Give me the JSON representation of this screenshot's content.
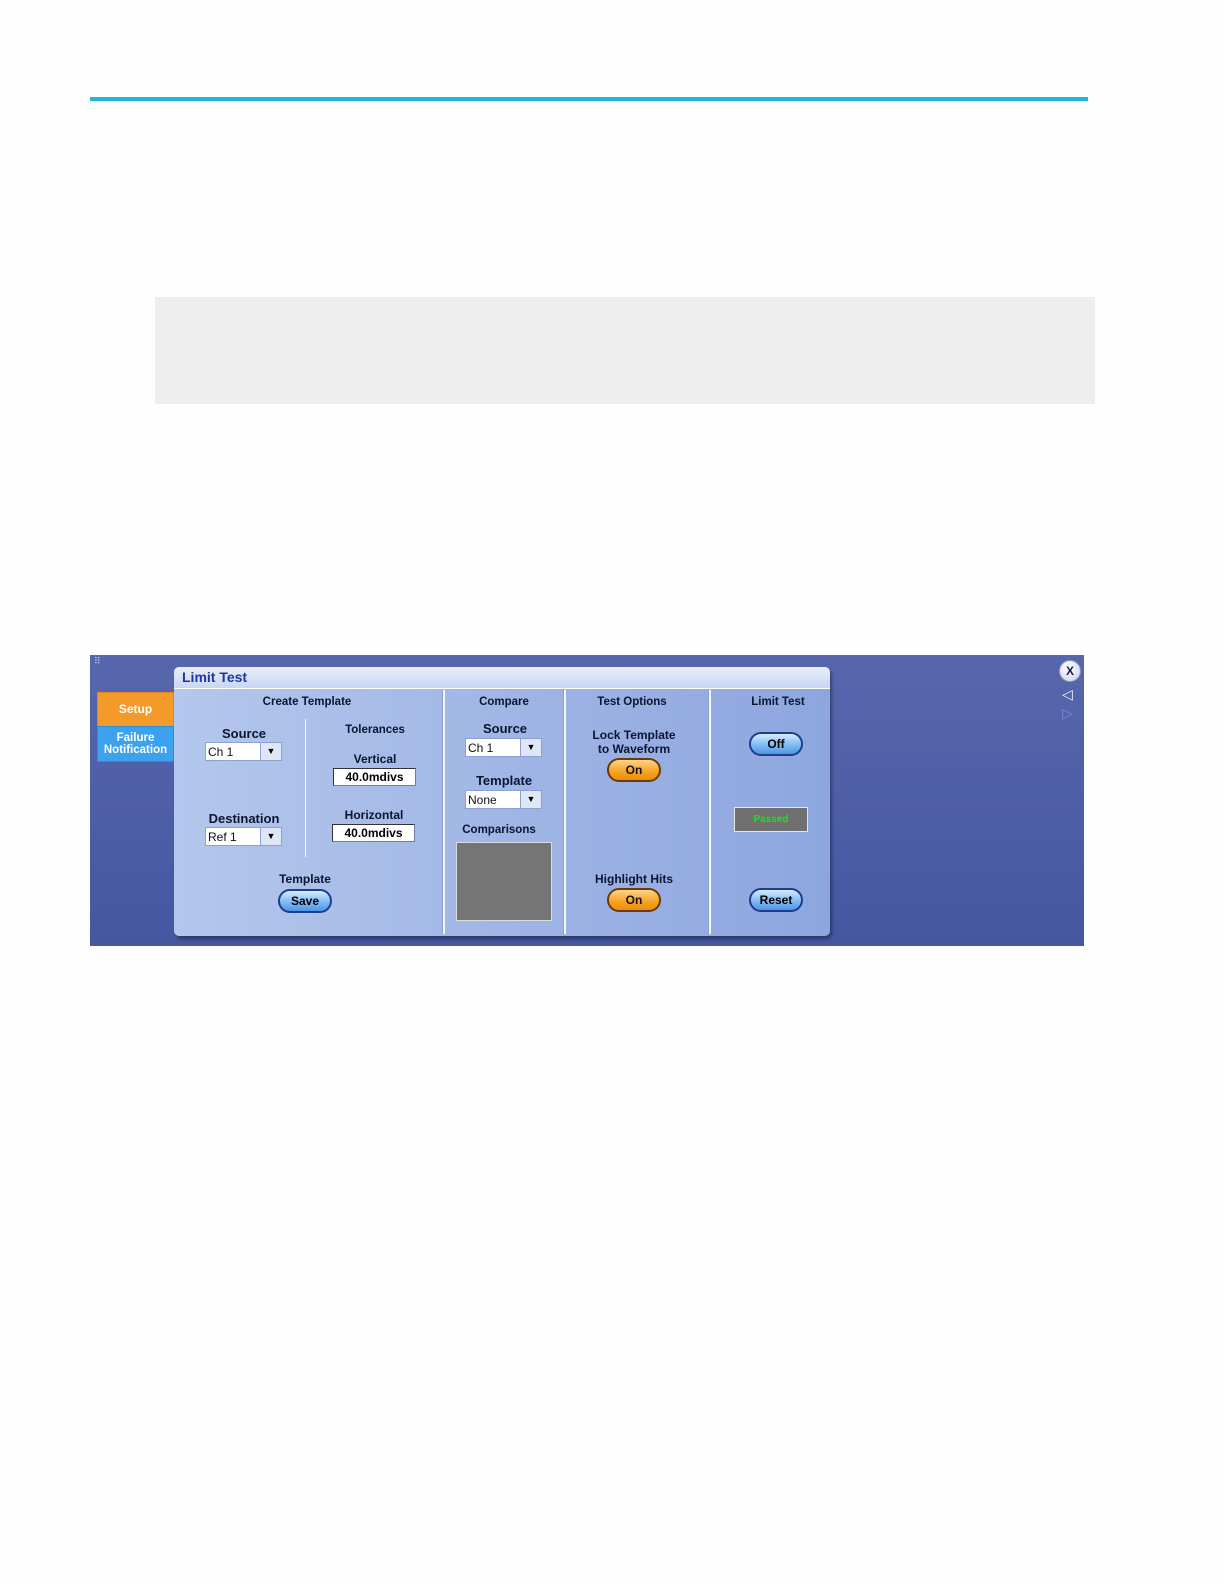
{
  "panel": {
    "title": "Limit Test",
    "tabs": [
      {
        "label": "Setup",
        "active": true
      },
      {
        "label": "Failure\nNotification",
        "active": false
      }
    ]
  },
  "create_template": {
    "heading": "Create Template",
    "source_label": "Source",
    "source_value": "Ch 1",
    "destination_label": "Destination",
    "destination_value": "Ref 1",
    "tolerances_label": "Tolerances",
    "vertical_label": "Vertical",
    "vertical_value": "40.0mdivs",
    "horizontal_label": "Horizontal",
    "horizontal_value": "40.0mdivs",
    "template_label": "Template",
    "save_label": "Save"
  },
  "compare": {
    "heading": "Compare",
    "source_label": "Source",
    "source_value": "Ch 1",
    "template_label": "Template",
    "template_value": "None",
    "comparisons_label": "Comparisons"
  },
  "test_options": {
    "heading": "Test Options",
    "lock_label_line1": "Lock Template",
    "lock_label_line2": "to Waveform",
    "lock_value": "On",
    "highlight_label": "Highlight Hits",
    "highlight_value": "On"
  },
  "limit_test": {
    "heading": "Limit Test",
    "toggle_value": "Off",
    "status": "Passed",
    "reset_label": "Reset"
  },
  "window": {
    "close_label": "X",
    "nav_left": "◁",
    "nav_right": "▷",
    "grip": "⠿"
  },
  "colors": {
    "header_rule": "#29b3d4",
    "tab_active": "#f39a2a",
    "tab_inactive": "#3ca2ee",
    "status_text": "#22dd22"
  }
}
